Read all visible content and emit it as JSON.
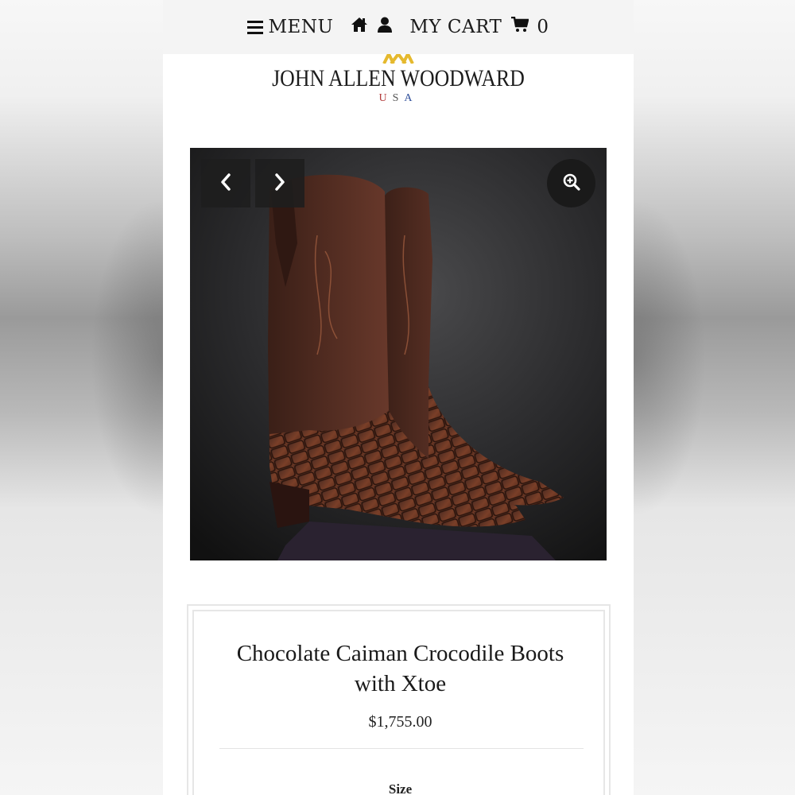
{
  "header": {
    "menu_label": "MENU",
    "home_icon": "home-icon",
    "account_icon": "user-icon",
    "cart_label": "MY CART",
    "cart_icon": "shopping-cart-icon",
    "cart_count": "0"
  },
  "logo": {
    "name": "JOHN ALLEN WOODWARD",
    "tagline_u": "U",
    "tagline_s": "S",
    "tagline_a": "A",
    "mark_color": "#e5b92e"
  },
  "gallery": {
    "prev_icon": "chevron-left-icon",
    "next_icon": "chevron-right-icon",
    "zoom_icon": "zoom-in-icon"
  },
  "product": {
    "title": "Chocolate Caiman Crocodile Boots with Xtoe",
    "price": "$1,755.00",
    "size_label": "Size"
  },
  "colors": {
    "topbar_bg": "#f4f4f4",
    "text": "#1a1a1a",
    "usa_red": "#b23a3a",
    "usa_blue": "#2f4f9a"
  }
}
